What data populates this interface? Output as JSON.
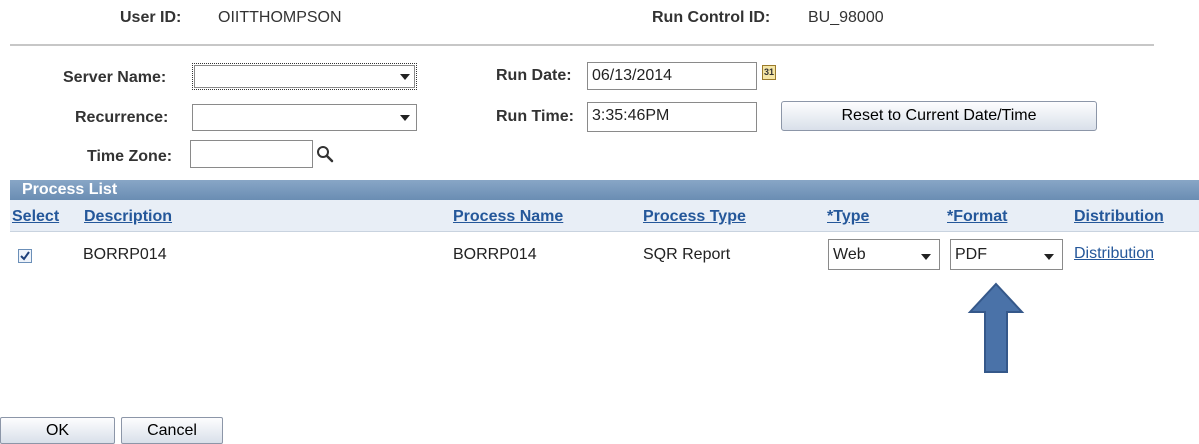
{
  "header": {
    "user_id_label": "User ID:",
    "user_id_value": "OIITTHOMPSON",
    "run_control_label": "Run Control ID:",
    "run_control_value": "BU_98000"
  },
  "form": {
    "server_name_label": "Server Name:",
    "server_name_value": "",
    "recurrence_label": "Recurrence:",
    "recurrence_value": "",
    "time_zone_label": "Time Zone:",
    "time_zone_value": "",
    "run_date_label": "Run Date:",
    "run_date_value": "06/13/2014",
    "calendar_icon_text": "31",
    "run_time_label": "Run Time:",
    "run_time_value": "3:35:46PM",
    "reset_button_label": "Reset to Current Date/Time"
  },
  "process_list": {
    "title": "Process List",
    "columns": {
      "select": "Select",
      "description": "Description",
      "process_name": "Process Name",
      "process_type": "Process Type",
      "type": "*Type",
      "format": "*Format",
      "distribution": "Distribution"
    },
    "rows": [
      {
        "selected": true,
        "description": "BORRP014",
        "process_name": "BORRP014",
        "process_type": "SQR Report",
        "type": "Web",
        "format": "PDF",
        "distribution": "Distribution"
      }
    ]
  },
  "footer": {
    "ok_label": "OK",
    "cancel_label": "Cancel"
  },
  "colors": {
    "link": "#24579a",
    "grid_header": "#6a8db3",
    "annotation_arrow": "#4a72a8"
  },
  "icons": {
    "calendar": "calendar-icon",
    "lookup": "magnifier-icon",
    "checkbox": "checkbox-checked-icon",
    "annotation": "up-arrow-icon"
  }
}
